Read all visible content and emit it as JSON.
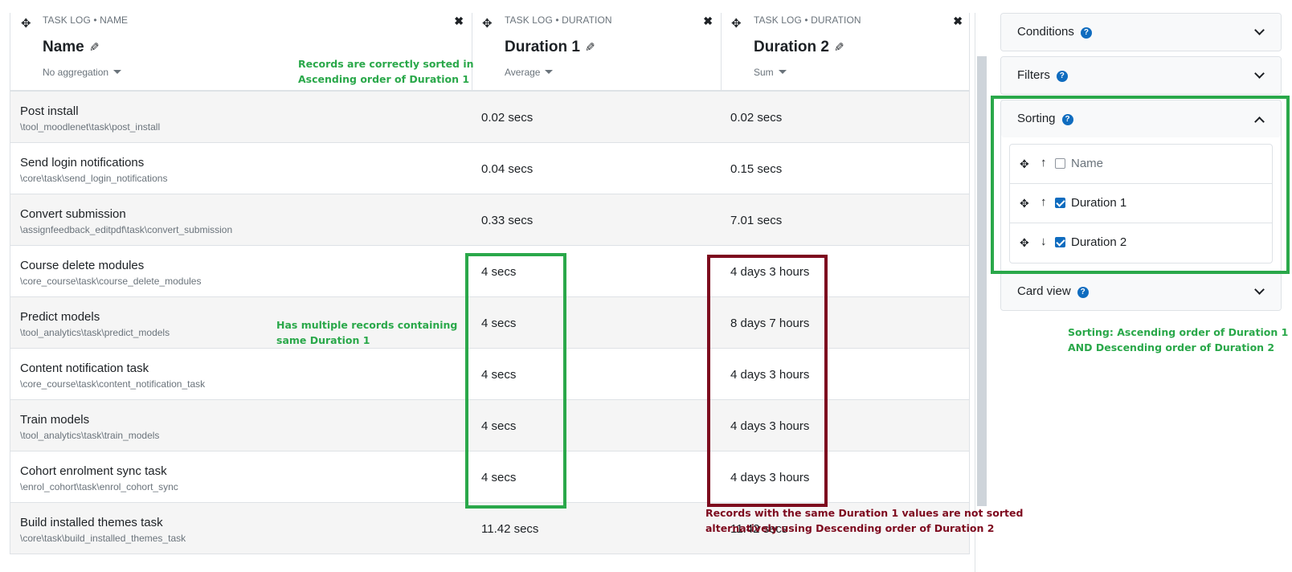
{
  "report": {
    "columns": [
      {
        "source": "TASK LOG • NAME",
        "title": "Name",
        "aggregation": "No aggregation"
      },
      {
        "source": "TASK LOG • DURATION",
        "title": "Duration 1",
        "aggregation": "Average"
      },
      {
        "source": "TASK LOG • DURATION",
        "title": "Duration 2",
        "aggregation": "Sum"
      }
    ],
    "rows": [
      {
        "name": "Post install",
        "path": "\\tool_moodlenet\\task\\post_install",
        "d1": "0.02 secs",
        "d2": "0.02 secs"
      },
      {
        "name": "Send login notifications",
        "path": "\\core\\task\\send_login_notifications",
        "d1": "0.04 secs",
        "d2": "0.15 secs"
      },
      {
        "name": "Convert submission",
        "path": "\\assignfeedback_editpdf\\task\\convert_submission",
        "d1": "0.33 secs",
        "d2": "7.01 secs"
      },
      {
        "name": "Course delete modules",
        "path": "\\core_course\\task\\course_delete_modules",
        "d1": "4 secs",
        "d2": "4 days 3 hours"
      },
      {
        "name": "Predict models",
        "path": "\\tool_analytics\\task\\predict_models",
        "d1": "4 secs",
        "d2": "8 days 7 hours"
      },
      {
        "name": "Content notification task",
        "path": "\\core_course\\task\\content_notification_task",
        "d1": "4 secs",
        "d2": "4 days 3 hours"
      },
      {
        "name": "Train models",
        "path": "\\tool_analytics\\task\\train_models",
        "d1": "4 secs",
        "d2": "4 days 3 hours"
      },
      {
        "name": "Cohort enrolment sync task",
        "path": "\\enrol_cohort\\task\\enrol_cohort_sync",
        "d1": "4 secs",
        "d2": "4 days 3 hours"
      },
      {
        "name": "Build installed themes task",
        "path": "\\core\\task\\build_installed_themes_task",
        "d1": "11.42 secs",
        "d2": "11.42 secs"
      }
    ]
  },
  "icons": {
    "move": "move-icon",
    "close": "close-icon",
    "edit": "pencil-icon",
    "help": "help-icon",
    "expand": "chevron-down-icon",
    "collapse": "chevron-up-icon"
  },
  "sidebar": {
    "conditions": {
      "label": "Conditions",
      "help": "?"
    },
    "filters": {
      "label": "Filters",
      "help": "?"
    },
    "sorting": {
      "label": "Sorting",
      "help": "?",
      "items": [
        {
          "label": "Name",
          "direction": "↑",
          "checked": false
        },
        {
          "label": "Duration 1",
          "direction": "↑",
          "checked": true
        },
        {
          "label": "Duration 2",
          "direction": "↓",
          "checked": true
        }
      ]
    },
    "card_view": {
      "label": "Card view",
      "help": "?"
    }
  },
  "annotations": {
    "sorted_note_line1": "Records are correctly sorted in",
    "sorted_note_line2": "Ascending order of Duration 1",
    "duplicates_note_line1": "Has multiple records containing",
    "duplicates_note_line2": "same Duration 1",
    "sorting_note_line1": "Sorting: Ascending order of Duration 1",
    "sorting_note_line2": "AND Descending order of Duration 2",
    "bug_note_line1": "Records with the same Duration 1 values are not sorted",
    "bug_note_line2": "alternatively using Descending order of Duration 2"
  },
  "colors": {
    "annotation_green": "#2aa84a",
    "annotation_red": "#7d0a1e",
    "link_blue": "#0f6cbf"
  }
}
